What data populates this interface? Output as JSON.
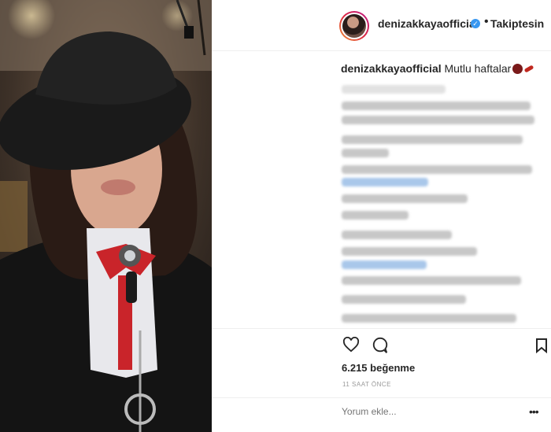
{
  "post": {
    "username": "denizakkayaofficial",
    "verified_icon": "verified-badge-icon",
    "separator": "•",
    "follow_status": "Takiptesin",
    "caption_user": "denizakkayaofficial",
    "caption_text": "Mutlu haftalar",
    "likes": "6.215 beğenme",
    "timestamp": "11 SAAT ÖNCE",
    "comment_placeholder": "Yorum ekle...",
    "more_options": "•••"
  },
  "colors": {
    "verified": "#3897f0",
    "text": "#262626",
    "muted": "#999999",
    "avatar_ring_start": "#f09433",
    "avatar_ring_end": "#bc1888"
  }
}
